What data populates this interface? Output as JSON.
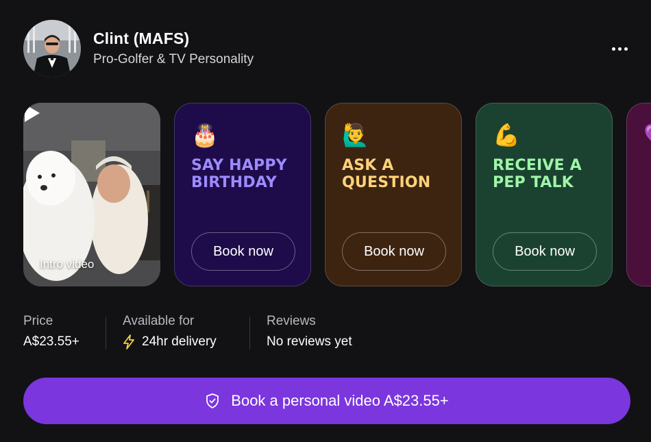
{
  "profile": {
    "name": "Clint (MAFS)",
    "subtitle": "Pro-Golfer & TV Personality"
  },
  "intro_video": {
    "label": "Intro video"
  },
  "services": [
    {
      "emoji": "🎂",
      "title": "SAY HAPPY BIRTHDAY",
      "button": "Book now",
      "accent": "#9d8bff",
      "bg": "#1e0b4a"
    },
    {
      "emoji": "🙋‍♂️",
      "title": "ASK A QUESTION",
      "button": "Book now",
      "accent": "#ffd27a",
      "bg": "#3d2411"
    },
    {
      "emoji": "💪",
      "title": "RECEIVE A PEP TALK",
      "button": "Book now",
      "accent": "#9ff5a8",
      "bg": "#1b4230"
    },
    {
      "emoji": "💜",
      "title": "",
      "button": "",
      "accent": "#ff8cd6",
      "bg": "#4a0f3a"
    }
  ],
  "stats": {
    "price": {
      "label": "Price",
      "value": "A$23.55+"
    },
    "availability": {
      "label": "Available for",
      "value": "24hr delivery",
      "icon": "lightning-bolt-icon"
    },
    "reviews": {
      "label": "Reviews",
      "value": "No reviews yet"
    }
  },
  "cta": {
    "label": "Book a personal video A$23.55+",
    "icon": "shield-check-icon",
    "color": "#7b36de"
  }
}
